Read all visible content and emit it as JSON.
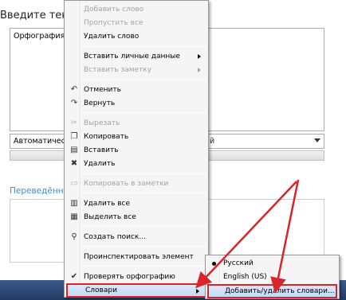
{
  "page": {
    "heading": "Введите текст",
    "textarea_value": "Орфография",
    "language_select_visible": "Автоматическ",
    "language_select_tail": "й",
    "translated_label": "Переведённый"
  },
  "context_menu": {
    "items": [
      {
        "label": "Добавить слово",
        "enabled": false
      },
      {
        "label": "Пропустить все",
        "enabled": false
      },
      {
        "label": "Удалить слово",
        "enabled": true
      },
      {
        "label": "Вставить личные данные",
        "enabled": true,
        "submenu": true
      },
      {
        "label": "Вставить заметку",
        "enabled": false,
        "submenu": true
      },
      {
        "label": "Отменить",
        "enabled": true,
        "icon": "undo-icon"
      },
      {
        "label": "Вернуть",
        "enabled": true,
        "icon": "redo-icon"
      },
      {
        "label": "Вырезать",
        "enabled": false,
        "icon": "cut-icon"
      },
      {
        "label": "Копировать",
        "enabled": true,
        "icon": "copy-icon"
      },
      {
        "label": "Вставить",
        "enabled": true,
        "icon": "paste-icon"
      },
      {
        "label": "Удалить",
        "enabled": true,
        "icon": "delete-icon"
      },
      {
        "label": "Копировать в заметки",
        "enabled": false,
        "icon": "notes-icon"
      },
      {
        "label": "Удалить все",
        "enabled": true,
        "icon": "delete-all-icon"
      },
      {
        "label": "Выделить все",
        "enabled": true,
        "icon": "select-all-icon"
      },
      {
        "label": "Создать поиск...",
        "enabled": true,
        "icon": "search-icon"
      },
      {
        "label": "Проинспектировать элемент",
        "enabled": true
      },
      {
        "label": "Проверять орфографию",
        "enabled": true,
        "checked": true
      },
      {
        "label": "Словари",
        "enabled": true,
        "submenu": true,
        "highlighted": true
      }
    ]
  },
  "dictionaries_submenu": {
    "items": [
      {
        "label": "Русский",
        "selected": true
      },
      {
        "label": "English (US)",
        "selected": false
      },
      {
        "label": "Добавить/удалить словари...",
        "highlighted": true
      }
    ]
  },
  "colors": {
    "highlight_border": "#d9242a",
    "link_blue": "#3f8bd1",
    "menu_background": "#f5f5f5"
  }
}
